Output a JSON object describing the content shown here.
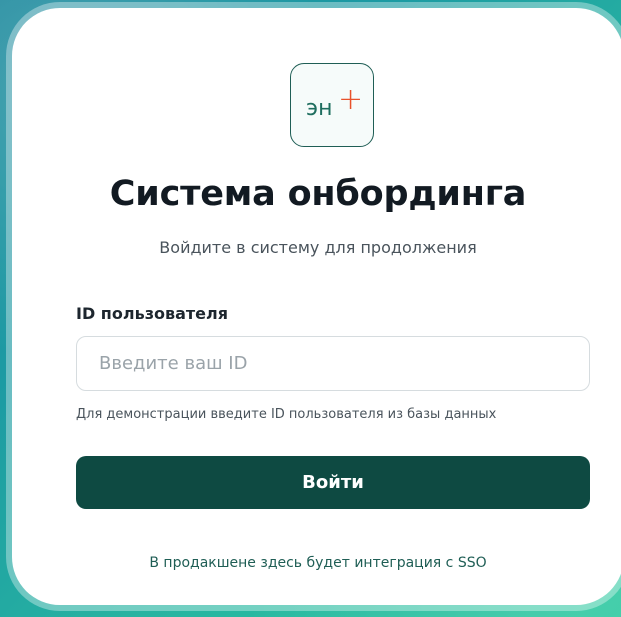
{
  "logo": {
    "text": "эн",
    "mark": "+",
    "text_color": "#1f6e5f",
    "mark_color": "#e8512a"
  },
  "header": {
    "title": "Система онбординга",
    "subtitle": "Войдите в систему для продолжения"
  },
  "form": {
    "user_id_label": "ID пользователя",
    "user_id_value": "",
    "user_id_placeholder": "Введите ваш ID",
    "hint": "Для демонстрации введите ID пользователя из базы данных",
    "submit_label": "Войти"
  },
  "footer": {
    "note": "В продакшене здесь будет интеграция с SSO"
  },
  "colors": {
    "primary": "#0e4a42",
    "accent": "#e8512a"
  }
}
